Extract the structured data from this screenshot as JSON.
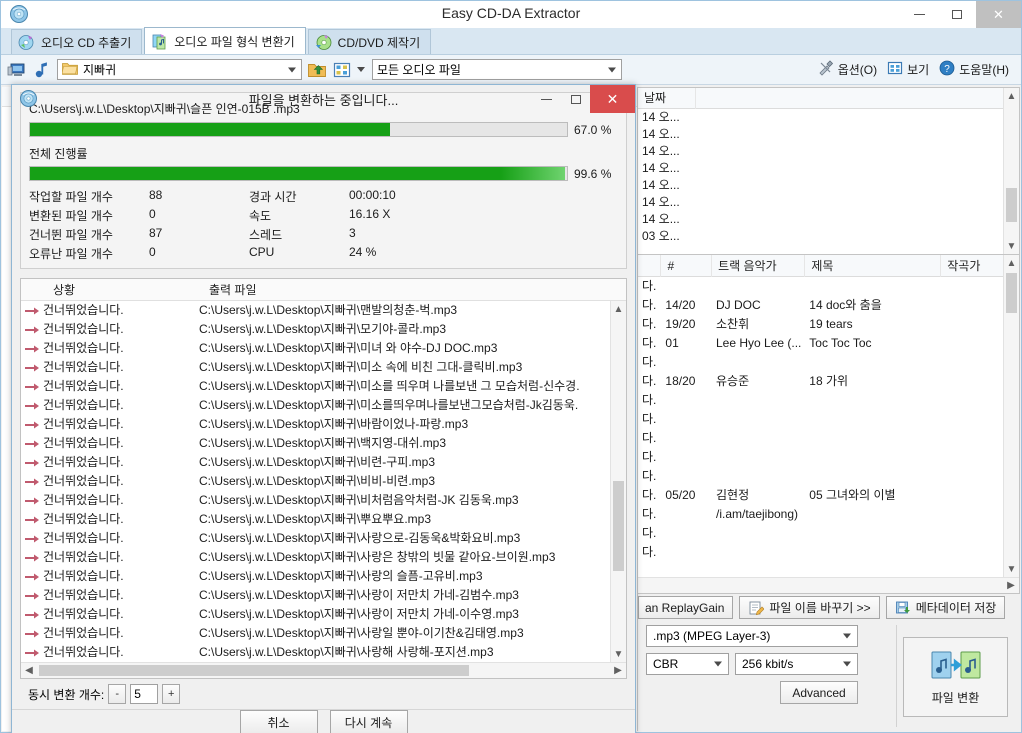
{
  "main_window": {
    "title": "Easy CD-DA Extractor",
    "icon": "cd-disc-icon",
    "buttons": {
      "minimize": "—",
      "maximize": "□",
      "close": "✕"
    }
  },
  "tabs": [
    {
      "label": "오디오 CD 추출기",
      "icon": "cd-extract-icon",
      "active": false
    },
    {
      "label": "오디오 파일 형식 변환기",
      "icon": "file-convert-icon",
      "active": true
    },
    {
      "label": "CD/DVD 제작기",
      "icon": "cd-burn-icon",
      "active": false
    }
  ],
  "toolbar": {
    "icons": [
      "computer-icon",
      "music-note-icon"
    ],
    "folder_value": "지빠귀",
    "folder_icon": "folder-icon",
    "up_folder_icon": "folder-up-icon",
    "view_icon": "view-grid-icon",
    "dropdown_icon": "chevron-down-icon",
    "filter_value": "모든 오디오 파일",
    "right_items": [
      {
        "label": "옵션(O)",
        "icon": "tools-icon"
      },
      {
        "label": "보기",
        "icon": "view-icon"
      },
      {
        "label": "도움말(H)",
        "icon": "help-icon"
      }
    ]
  },
  "right_pane": {
    "file_table": {
      "headers": [
        "날짜",
        ""
      ],
      "rows": [
        "14 오...",
        "14 오...",
        "14 오...",
        "14 오...",
        "14 오...",
        "14 오...",
        "14 오...",
        "03 오..."
      ]
    },
    "track_table": {
      "headers": [
        "",
        "#",
        "트랙 음악가",
        "제목",
        "작곡가"
      ],
      "rows": [
        {
          "da": "다.",
          "num": "",
          "artist": "",
          "title": "",
          "composer": ""
        },
        {
          "da": "다.",
          "num": "14/20",
          "artist": "DJ DOC",
          "title": "14 doc와 춤을",
          "composer": ""
        },
        {
          "da": "다.",
          "num": "19/20",
          "artist": "소찬휘",
          "title": "19 tears",
          "composer": ""
        },
        {
          "da": "다.",
          "num": "01",
          "artist": "Lee Hyo Lee (...",
          "title": "Toc Toc Toc",
          "composer": ""
        },
        {
          "da": "다.",
          "num": "",
          "artist": "",
          "title": "",
          "composer": ""
        },
        {
          "da": "다.",
          "num": "18/20",
          "artist": "유승준",
          "title": "18 가위",
          "composer": ""
        },
        {
          "da": "다.",
          "num": "",
          "artist": "",
          "title": "",
          "composer": ""
        },
        {
          "da": "다.",
          "num": "",
          "artist": "",
          "title": "",
          "composer": ""
        },
        {
          "da": "다.",
          "num": "",
          "artist": "",
          "title": "",
          "composer": ""
        },
        {
          "da": "다.",
          "num": "",
          "artist": "",
          "title": "",
          "composer": ""
        },
        {
          "da": "다.",
          "num": "",
          "artist": "",
          "title": "",
          "composer": ""
        },
        {
          "da": "다.",
          "num": "05/20",
          "artist": "김현정",
          "title": "05 그녀와의 이별",
          "composer": ""
        },
        {
          "da": "다.",
          "num": "",
          "artist": "/i.am/taejibong)",
          "title": "",
          "composer": ""
        },
        {
          "da": "다.",
          "num": "",
          "artist": "",
          "title": "",
          "composer": ""
        },
        {
          "da": "다.",
          "num": "",
          "artist": "",
          "title": "",
          "composer": ""
        }
      ]
    },
    "action_buttons": [
      {
        "label": "an ReplayGain",
        "icon": "replaygain-icon"
      },
      {
        "label": "파일 이름 바꾸기 >>",
        "icon": "rename-icon"
      },
      {
        "label": "메타데이터 저장",
        "icon": "metadata-save-icon"
      }
    ],
    "format": {
      "codec": ".mp3 (MPEG Layer-3)",
      "mode": "CBR",
      "bitrate": "256 kbit/s",
      "advanced_label": "Advanced"
    },
    "convert_button": {
      "label": "파일 변환",
      "icon": "convert-files-icon"
    }
  },
  "dialog": {
    "title": "파일을 변환하는 중입니다...",
    "icon": "cd-disc-icon",
    "buttons": {
      "minimize": "—",
      "maximize": "□",
      "close": "✕"
    },
    "current_file": "C:\\Users\\j.w.L\\Desktop\\지빠귀\\슬픈 인연-015B .mp3",
    "current_progress_pct": "67.0 %",
    "current_progress_value": 67.0,
    "overall_label": "전체 진행률",
    "overall_progress_pct": "99.6 %",
    "overall_progress_value": 99.6,
    "stats_left": [
      {
        "label": "작업할 파일 개수",
        "value": "88"
      },
      {
        "label": "변환된 파일 개수",
        "value": "0"
      },
      {
        "label": "건너뛴 파일 개수",
        "value": "87"
      },
      {
        "label": "오류난 파일 개수",
        "value": "0"
      }
    ],
    "stats_right": [
      {
        "label": "경과 시간",
        "value": "00:00:10"
      },
      {
        "label": "속도",
        "value": "16.16 X"
      },
      {
        "label": "스레드",
        "value": "3"
      },
      {
        "label": "CPU",
        "value": "24 %"
      }
    ],
    "log_headers": {
      "status": "상황",
      "output": "출력 파일"
    },
    "log_rows": [
      {
        "status": "건너뛰었습니다.",
        "path": "C:\\Users\\j.w.L\\Desktop\\지빠귀\\맨발의청춘-벅.mp3"
      },
      {
        "status": "건너뛰었습니다.",
        "path": "C:\\Users\\j.w.L\\Desktop\\지빠귀\\모기야-콜라.mp3"
      },
      {
        "status": "건너뛰었습니다.",
        "path": "C:\\Users\\j.w.L\\Desktop\\지빠귀\\미녀 와 야수-DJ DOC.mp3"
      },
      {
        "status": "건너뛰었습니다.",
        "path": "C:\\Users\\j.w.L\\Desktop\\지빠귀\\미소 속에 비친 그대-클릭비.mp3"
      },
      {
        "status": "건너뛰었습니다.",
        "path": "C:\\Users\\j.w.L\\Desktop\\지빠귀\\미소를 띄우며 나를보낸 그 모습처럼-신수경."
      },
      {
        "status": "건너뛰었습니다.",
        "path": "C:\\Users\\j.w.L\\Desktop\\지빠귀\\미소를띄우며나를보낸그모습처럼-Jk김동욱."
      },
      {
        "status": "건너뛰었습니다.",
        "path": "C:\\Users\\j.w.L\\Desktop\\지빠귀\\바람이었나-파랑.mp3"
      },
      {
        "status": "건너뛰었습니다.",
        "path": "C:\\Users\\j.w.L\\Desktop\\지빠귀\\백지영-대쉬.mp3"
      },
      {
        "status": "건너뛰었습니다.",
        "path": "C:\\Users\\j.w.L\\Desktop\\지빠귀\\비련-구피.mp3"
      },
      {
        "status": "건너뛰었습니다.",
        "path": "C:\\Users\\j.w.L\\Desktop\\지빠귀\\비비-비련.mp3"
      },
      {
        "status": "건너뛰었습니다.",
        "path": "C:\\Users\\j.w.L\\Desktop\\지빠귀\\비처럼음악처럼-JK 김동욱.mp3"
      },
      {
        "status": "건너뛰었습니다.",
        "path": "C:\\Users\\j.w.L\\Desktop\\지빠귀\\뿌요뿌요.mp3"
      },
      {
        "status": "건너뛰었습니다.",
        "path": "C:\\Users\\j.w.L\\Desktop\\지빠귀\\사랑으로-김동욱&박화요비.mp3"
      },
      {
        "status": "건너뛰었습니다.",
        "path": "C:\\Users\\j.w.L\\Desktop\\지빠귀\\사랑은 창밖의 빗물 같아요-브이원.mp3"
      },
      {
        "status": "건너뛰었습니다.",
        "path": "C:\\Users\\j.w.L\\Desktop\\지빠귀\\사랑의 슬픔-고유비.mp3"
      },
      {
        "status": "건너뛰었습니다.",
        "path": "C:\\Users\\j.w.L\\Desktop\\지빠귀\\사랑이 저만치 가네-김범수.mp3"
      },
      {
        "status": "건너뛰었습니다.",
        "path": "C:\\Users\\j.w.L\\Desktop\\지빠귀\\사랑이 저만치 가네-이수영.mp3"
      },
      {
        "status": "건너뛰었습니다.",
        "path": "C:\\Users\\j.w.L\\Desktop\\지빠귀\\사랑일 뿐야-이기찬&김태영.mp3"
      },
      {
        "status": "건너뛰었습니다.",
        "path": "C:\\Users\\j.w.L\\Desktop\\지빠귀\\사랑해 사랑해-포지션.mp3"
      }
    ],
    "concurrent_label": "동시 변환 개수:",
    "concurrent_minus": "-",
    "concurrent_value": "5",
    "concurrent_plus": "+",
    "footer_buttons": [
      {
        "label": "취소"
      },
      {
        "label": "다시 계속"
      }
    ]
  },
  "colors": {
    "progress_green": "#16a016",
    "dialog_titlebar": "#9fc2dc",
    "close_red": "#d94c4c",
    "arrow_red": "#c05a6e"
  }
}
